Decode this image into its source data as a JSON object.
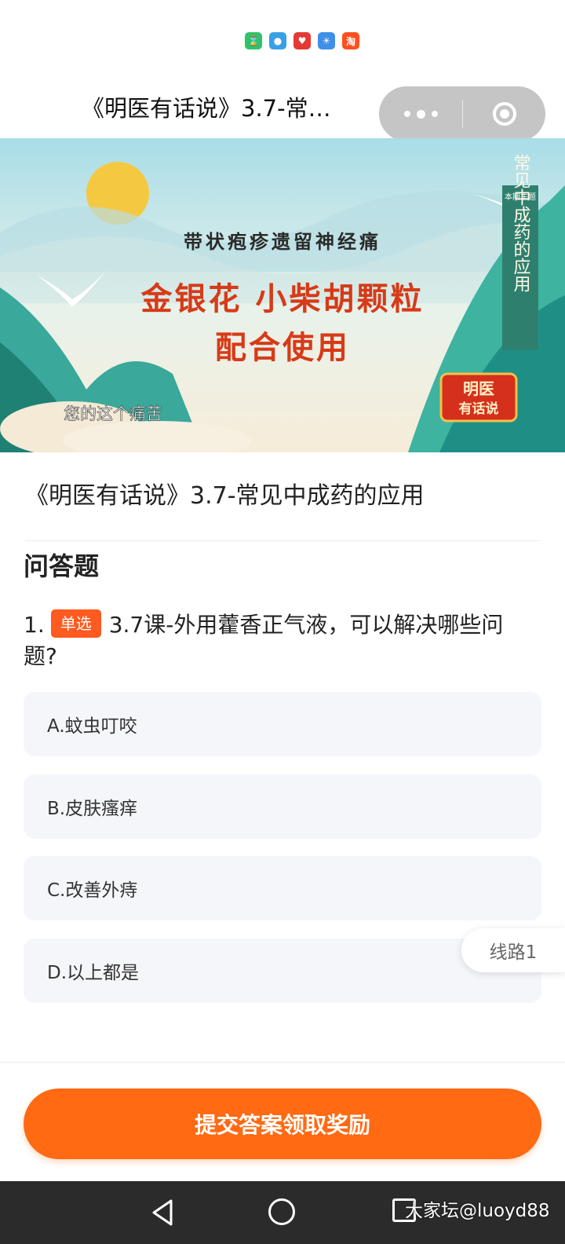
{
  "status_bar": {
    "icons": [
      {
        "name": "timer-app-icon",
        "color": "#2ec36b",
        "glyph": "⌛"
      },
      {
        "name": "ball-app-icon",
        "color": "#3aa0e6",
        "glyph": "●"
      },
      {
        "name": "heart-app-icon",
        "color": "#e53935",
        "glyph": "♥"
      },
      {
        "name": "weather-app-icon",
        "color": "#3f8fe8",
        "glyph": "☀"
      },
      {
        "name": "taobao-app-icon",
        "color": "#ff4f1f",
        "glyph": "淘"
      }
    ]
  },
  "header": {
    "title": "《明医有话说》3.7-常…"
  },
  "video": {
    "subtitle_top": "带状疱疹遗留神经痛",
    "headline_line1": "金银花  小柴胡颗粒",
    "headline_line2": "配合使用",
    "caption": "您的这个痛苦",
    "banner_top": "本期主题",
    "banner_text": "常见中成药的应用",
    "logo_line1": "明医",
    "logo_line2": "有话说"
  },
  "lesson": {
    "title": "《明医有话说》3.7-常见中成药的应用"
  },
  "section": {
    "title": "问答题"
  },
  "question": {
    "number": "1.",
    "tag": "单选",
    "text": "3.7课-外用藿香正气液，可以解决哪些问题?"
  },
  "options": [
    {
      "label": "A.蚊虫叮咬"
    },
    {
      "label": "B.皮肤瘙痒"
    },
    {
      "label": "C.改善外痔"
    },
    {
      "label": "D.以上都是"
    }
  ],
  "route_button": "线路1",
  "submit_button": "提交答案领取奖励",
  "watermark": "大家坛@luoyd88",
  "colors": {
    "accent": "#ff6a13",
    "tag": "#ff5a1f",
    "option_bg": "#f5f6fa"
  }
}
